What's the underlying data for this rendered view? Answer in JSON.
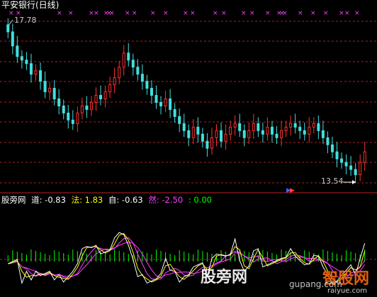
{
  "chart_title": "平安银行(日线)",
  "price_high_label": "17.78",
  "price_low_label": "13.54",
  "indicator": {
    "name_label": "股旁网",
    "dao_label": "道: -0.83",
    "fa_label": "法: 1.83",
    "zi_label": "自: -0.63",
    "ran_label": "然: -2.50",
    "zero_label": ": 0.00"
  },
  "watermark": {
    "left_text": "股旁网",
    "right_text": "智股网",
    "url1": "gupang.com",
    "url2": "raiyue.com"
  },
  "colors": {
    "background": "#000000",
    "up_candle": "#ff3030",
    "down_candle": "#40e0e0",
    "grid": "#aa2020",
    "marker": "#ff40ff",
    "dao_line": "#ffffff",
    "fa_line": "#ffff00",
    "zi_line": "#ff40ff",
    "ran_line": "#ff40ff",
    "zero_line": "#00ff00"
  },
  "chart_data": [
    {
      "type": "candlestick",
      "title": "平安银行(日线)",
      "series_close": [
        17.6,
        17.2,
        16.9,
        16.8,
        16.7,
        16.4,
        16.5,
        16.2,
        15.9,
        16.0,
        15.7,
        15.5,
        15.3,
        15.1,
        15.0,
        15.3,
        15.5,
        15.4,
        15.6,
        15.8,
        15.7,
        15.9,
        16.1,
        16.3,
        16.6,
        17.0,
        16.8,
        16.6,
        16.4,
        16.2,
        16.0,
        15.8,
        15.6,
        15.5,
        15.7,
        15.4,
        15.2,
        15.0,
        14.8,
        14.6,
        14.9,
        14.7,
        14.5,
        14.3,
        14.6,
        14.8,
        14.5,
        14.7,
        14.9,
        15.0,
        14.8,
        14.6,
        14.8,
        15.0,
        14.8,
        14.7,
        14.9,
        14.7,
        14.6,
        14.8,
        14.9,
        15.0,
        14.9,
        14.8,
        14.7,
        14.9,
        15.0,
        14.8,
        14.6,
        14.4,
        14.2,
        14.0,
        13.9,
        13.8,
        13.7,
        13.55,
        13.9,
        14.2
      ],
      "ylim": [
        13.4,
        17.9
      ],
      "high_label": "17.78",
      "low_label": "13.54"
    },
    {
      "type": "line",
      "series_names": [
        "道",
        "法",
        "自",
        "然"
      ],
      "last_values": [
        -0.83,
        1.83,
        -0.63,
        -2.5
      ],
      "zero": 0.0
    }
  ]
}
